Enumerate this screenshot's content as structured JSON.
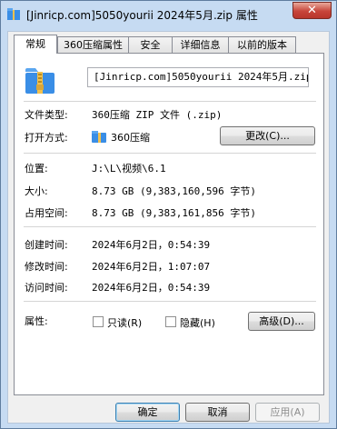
{
  "window": {
    "title": "[Jinricp.com]5050yourii 2024年5月.zip 属性",
    "close_glyph": "✕"
  },
  "tabs": [
    {
      "label": "常规"
    },
    {
      "label": "360压缩属性"
    },
    {
      "label": "安全"
    },
    {
      "label": "详细信息"
    },
    {
      "label": "以前的版本"
    }
  ],
  "general": {
    "file_name": "[Jinricp.com]5050yourii 2024年5月.zip",
    "file_type_label": "文件类型:",
    "file_type_value": "360压缩 ZIP 文件 (.zip)",
    "open_with_label": "打开方式:",
    "open_with_value": "360压缩",
    "change_button": "更改(C)...",
    "location_label": "位置:",
    "location_value": "J:\\L\\视频\\6.1",
    "size_label": "大小:",
    "size_value": "8.73 GB (9,383,160,596 字节)",
    "size_on_disk_label": "占用空间:",
    "size_on_disk_value": "8.73 GB (9,383,161,856 字节)",
    "created_label": "创建时间:",
    "created_value": "2024年6月2日，0:54:39",
    "modified_label": "修改时间:",
    "modified_value": "2024年6月2日，1:07:07",
    "accessed_label": "访问时间:",
    "accessed_value": "2024年6月2日，0:54:39",
    "attributes_label": "属性:",
    "readonly_label": "只读(R)",
    "hidden_label": "隐藏(H)",
    "advanced_button": "高级(D)..."
  },
  "footer": {
    "ok": "确定",
    "cancel": "取消",
    "apply": "应用(A)"
  },
  "colors": {
    "titlebar": "#c6dbf2",
    "close": "#c7453a",
    "folder_blue": "#3a8ee6",
    "zip_yellow": "#f2c14e"
  }
}
